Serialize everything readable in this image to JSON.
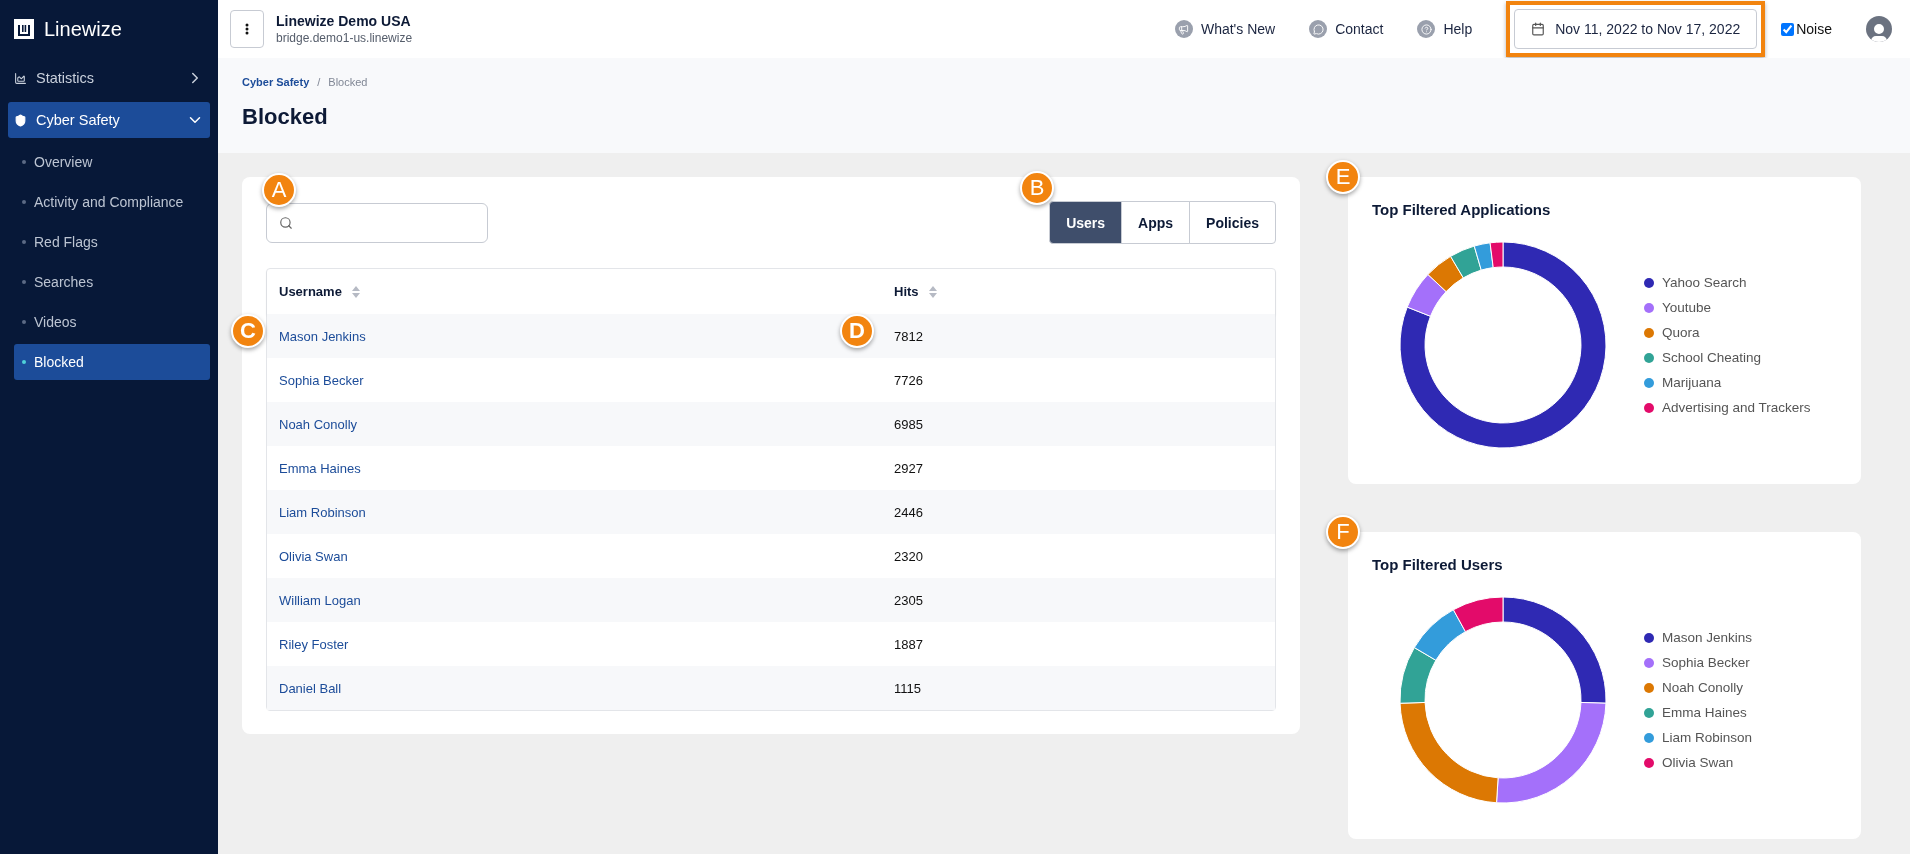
{
  "brand": {
    "name": "Linewize"
  },
  "sidebar": {
    "items": [
      {
        "label": "Statistics",
        "selected": false,
        "expanded": false
      },
      {
        "label": "Cyber Safety",
        "selected": true,
        "expanded": true,
        "children": [
          {
            "label": "Overview",
            "selected": false
          },
          {
            "label": "Activity and Compliance",
            "selected": false
          },
          {
            "label": "Red Flags",
            "selected": false
          },
          {
            "label": "Searches",
            "selected": false
          },
          {
            "label": "Videos",
            "selected": false
          },
          {
            "label": "Blocked",
            "selected": true
          }
        ]
      }
    ]
  },
  "topbar": {
    "org": "Linewize Demo USA",
    "host": "bridge.demo1-us.linewize",
    "links": [
      {
        "kind": "news",
        "label": "What's New"
      },
      {
        "kind": "contact",
        "label": "Contact"
      },
      {
        "kind": "help",
        "label": "Help"
      }
    ],
    "date_range": {
      "label": "Nov 11, 2022 to Nov 17, 2022",
      "highlighted": true
    },
    "noise": {
      "label": "Noise",
      "checked": true
    }
  },
  "breadcrumb": {
    "separator": "/",
    "items": [
      {
        "label": "Cyber Safety"
      },
      {
        "label": "Blocked"
      }
    ]
  },
  "page_title": "Blocked",
  "search": {
    "callout": "A"
  },
  "tabs": {
    "callout": "B",
    "items": [
      {
        "label": "Users",
        "selected": true
      },
      {
        "label": "Apps",
        "selected": false
      },
      {
        "label": "Policies",
        "selected": false
      }
    ]
  },
  "table": {
    "columns": [
      {
        "label": "Username",
        "callout": "C"
      },
      {
        "label": "Hits",
        "callout": "D"
      }
    ],
    "rows": [
      {
        "username": "Mason Jenkins",
        "hits": "7812"
      },
      {
        "username": "Sophia Becker",
        "hits": "7726"
      },
      {
        "username": "Noah Conolly",
        "hits": "6985"
      },
      {
        "username": "Emma Haines",
        "hits": "2927"
      },
      {
        "username": "Liam Robinson",
        "hits": "2446"
      },
      {
        "username": "Olivia Swan",
        "hits": "2320"
      },
      {
        "username": "William Logan",
        "hits": "2305"
      },
      {
        "username": "Riley Foster",
        "hits": "1887"
      },
      {
        "username": "Daniel Ball",
        "hits": "1115"
      }
    ]
  },
  "charts": [
    {
      "title": "Top Filtered Applications",
      "callout": "E",
      "legend": [
        {
          "label": "Yahoo Search",
          "color": "#2f29b3"
        },
        {
          "label": "Youtube",
          "color": "#a470fa"
        },
        {
          "label": "Quora",
          "color": "#dc7803"
        },
        {
          "label": "School Cheating",
          "color": "#31a396"
        },
        {
          "label": "Marijuana",
          "color": "#339cdb"
        },
        {
          "label": "Advertising and Trackers",
          "color": "#e30b6a"
        }
      ]
    },
    {
      "title": "Top Filtered Users",
      "callout": "F",
      "legend": [
        {
          "label": "Mason Jenkins",
          "color": "#2f29b3"
        },
        {
          "label": "Sophia Becker",
          "color": "#a470fa"
        },
        {
          "label": "Noah Conolly",
          "color": "#dc7803"
        },
        {
          "label": "Emma Haines",
          "color": "#31a396"
        },
        {
          "label": "Liam Robinson",
          "color": "#339cdb"
        },
        {
          "label": "Olivia Swan",
          "color": "#e30b6a"
        }
      ]
    }
  ]
}
